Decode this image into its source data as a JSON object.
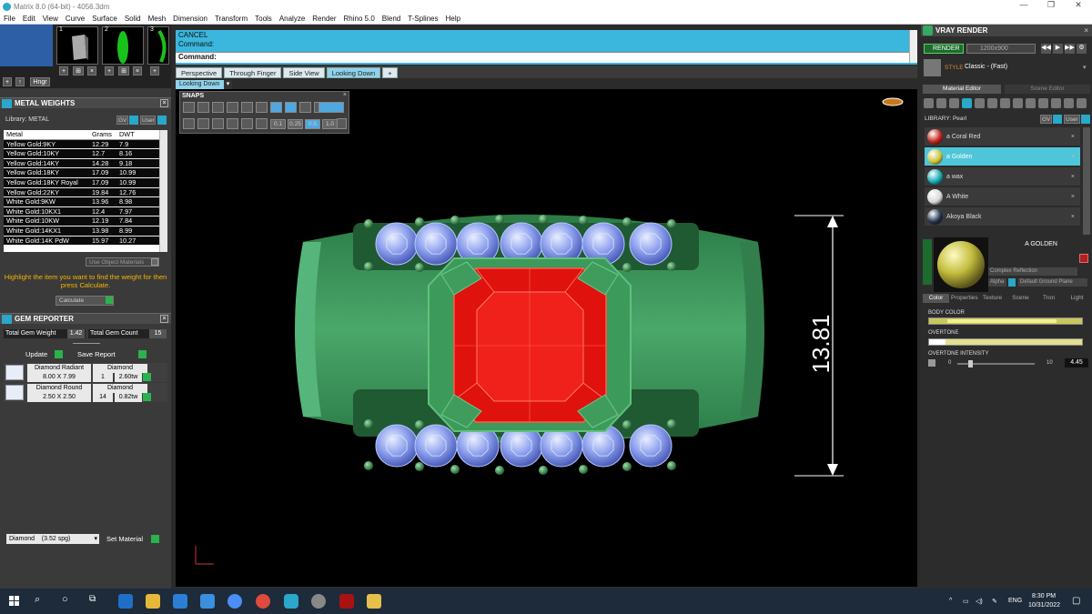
{
  "window": {
    "title": "Matrix 8.0 (64-bit) - 4056.3dm"
  },
  "menu": [
    "File",
    "Edit",
    "View",
    "Curve",
    "Surface",
    "Solid",
    "Mesh",
    "Dimension",
    "Transform",
    "Tools",
    "Analyze",
    "Render",
    "Rhino 5.0",
    "Blend",
    "T-Splines",
    "Help"
  ],
  "thumbs": {
    "labels": [
      "1",
      "2",
      "3"
    ],
    "hinge_label": "Hngr"
  },
  "metal_weights": {
    "title": "METAL WEIGHTS",
    "library_label": "Library: METAL",
    "gv": "GV",
    "user": "User",
    "columns": [
      "Metal",
      "Grams",
      "DWT"
    ],
    "rows": [
      [
        "Yellow Gold:9KY",
        "12.29",
        "7.9"
      ],
      [
        "Yellow Gold:10KY",
        "12.7",
        "8.16"
      ],
      [
        "Yellow Gold:14KY",
        "14.28",
        "9.18"
      ],
      [
        "Yellow Gold:18KY",
        "17.09",
        "10.99"
      ],
      [
        "Yellow Gold:18KY Royal",
        "17.09",
        "10.99"
      ],
      [
        "Yellow Gold:22KY",
        "19.84",
        "12.76"
      ],
      [
        "White Gold:9KW",
        "13.96",
        "8.98"
      ],
      [
        "White Gold:10KX1",
        "12.4",
        "7.97"
      ],
      [
        "White Gold:10KW",
        "12.19",
        "7.84"
      ],
      [
        "White Gold:14KX1",
        "13.98",
        "8.99"
      ],
      [
        "White Gold:14K PdW",
        "15.97",
        "10.27"
      ]
    ],
    "use_object_materials": "Use Object Materials",
    "hint": "Highlight the item you want to find the weight for then press Calculate.",
    "calculate": "Calculate"
  },
  "gem_reporter": {
    "title": "GEM REPORTER",
    "total_weight_label": "Total Gem Weight",
    "total_weight": "1.42",
    "total_count_label": "Total Gem Count",
    "total_count": "15",
    "update": "Update",
    "save_report": "Save Report",
    "gems": [
      {
        "name": "Diamond Radiant",
        "size": "8.00 X 7.99",
        "material": "Diamond",
        "count": "1",
        "weight": "2.60tw"
      },
      {
        "name": "Diamond Round",
        "size": "2.50 X 2.50",
        "material": "Diamond",
        "count": "14",
        "weight": "0.82tw"
      }
    ],
    "material_select": "Diamond",
    "material_sg": "(3.52 spg)",
    "set_material": "Set Material"
  },
  "command": {
    "line1": "CANCEL",
    "line2": "Command:",
    "prompt": "Command:"
  },
  "view_tabs": [
    "Perspective",
    "Through Finger",
    "Side View",
    "Looking Down"
  ],
  "active_view": "Looking Down",
  "snaps": {
    "title": "SNAPS",
    "values": [
      "0.1",
      "0.25",
      "0.5",
      "1.0"
    ]
  },
  "dimension": {
    "value": "13.81"
  },
  "vray": {
    "title": "VRAY RENDER",
    "render": "RENDER",
    "resolution": "1200x900",
    "style_label": "STYLE",
    "style_value": "Classic - (Fast)",
    "material_editor_tab": "Material Editor",
    "scene_editor_tab": "Scene Editor",
    "library_label": "LIBRARY: Pearl",
    "gv": "GV",
    "user": "User",
    "materials": [
      {
        "name": "a Coral Red",
        "color": "#c0241c"
      },
      {
        "name": "a Golden",
        "color": "#c8c23a"
      },
      {
        "name": "a wax",
        "color": "#16a9b4"
      },
      {
        "name": "A White",
        "color": "#d8d8d8"
      },
      {
        "name": "Akoya Black",
        "color": "#22324a"
      }
    ],
    "selected_material": "A GOLDEN",
    "reflection": "Complex Reflection",
    "alpha": "Alpha",
    "ground_plane": "Default Ground Plane",
    "sub_tabs": [
      "Color",
      "Properties",
      "Texture",
      "Scene",
      "Tron",
      "Light"
    ],
    "body_color_label": "BODY COLOR",
    "overtone_label": "OVERTONE",
    "overtone_intensity_label": "OVERTONE INTENSITY",
    "intensity_min": "0",
    "intensity_max": "10",
    "intensity_value": "4.45"
  },
  "taskbar": {
    "lang": "ENG",
    "time": "8:30 PM",
    "date": "10/31/2022"
  }
}
